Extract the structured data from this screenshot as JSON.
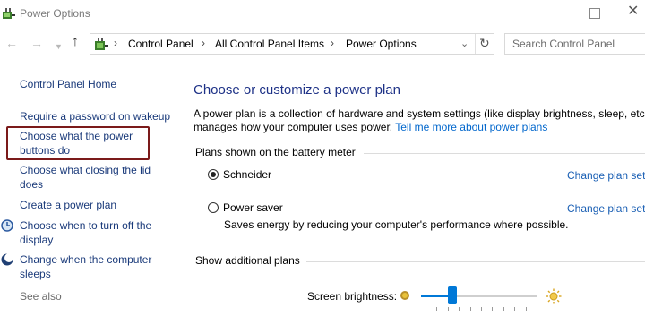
{
  "window": {
    "title": "Power Options"
  },
  "navbar": {
    "back_icon": "back-arrow-icon",
    "forward_icon": "forward-arrow-icon",
    "breadcrumbs": [
      "Control Panel",
      "All Control Panel Items",
      "Power Options"
    ],
    "search_placeholder": "Search Control Panel"
  },
  "sidebar": {
    "home": "Control Panel Home",
    "links": [
      "Require a password on wakeup",
      "Choose what the power buttons do",
      "Choose what closing the lid does",
      "Create a power plan",
      "Choose when to turn off the display",
      "Change when the computer sleeps"
    ],
    "see_also": "See also"
  },
  "main": {
    "title": "Choose or customize a power plan",
    "desc_line1": "A power plan is a collection of hardware and system settings (like display brightness, sleep, etc.)",
    "desc_line2": "manages how your computer uses power.",
    "desc_link": "Tell me more about power plans",
    "battery_section": "Plans shown on the battery meter",
    "plans": [
      {
        "name": "Schneider",
        "selected": true,
        "link": "Change plan settings",
        "description": ""
      },
      {
        "name": "Power saver",
        "selected": false,
        "link": "Change plan settings",
        "description": "Saves energy by reducing your computer's performance where possible."
      }
    ],
    "additional_plans": "Show additional plans"
  },
  "brightness": {
    "label": "Screen brightness:",
    "level": 0.27
  },
  "colors": {
    "link": "#1a3a7a",
    "title": "#1e3287",
    "accent": "#0078d7",
    "highlight": "#7b1a1a"
  }
}
